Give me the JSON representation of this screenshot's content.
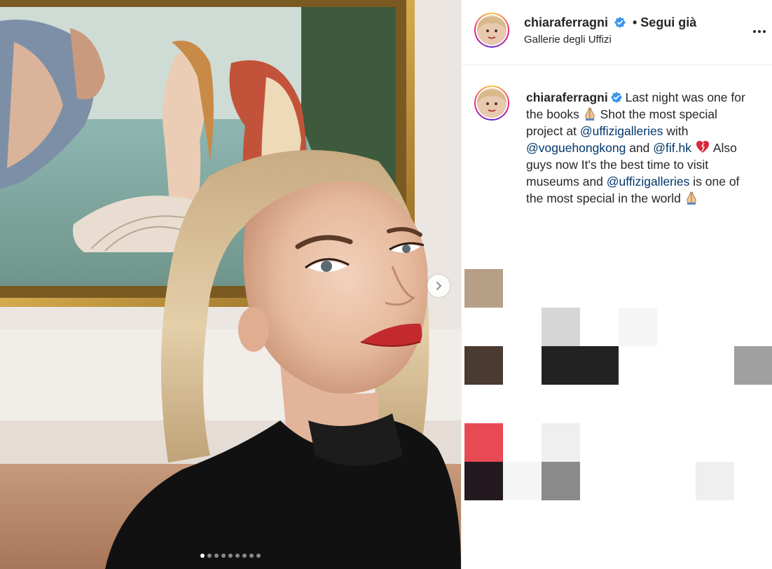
{
  "post": {
    "image_count": 9,
    "active_index": 0
  },
  "header": {
    "username": "chiaraferragni",
    "follow_status": "• Segui già",
    "location": "Gallerie degli Uffizi",
    "more_icon": "more-horizontal-icon"
  },
  "caption": {
    "username": "chiaraferragni",
    "part1": " Last night was one for the books ",
    "part2": " Shot the most special project at ",
    "mention1": "@uffizigalleries",
    "part3": " with ",
    "mention2": "@voguehongkong",
    "part4": " and ",
    "mention3": "@fif.hk",
    "part5": " Also guys now It's the best time to visit museums and ",
    "mention4": "@uffizigalleries",
    "part6": " is one of the most special in the world ",
    "emoji_pray": "folded-hands-emoji",
    "emoji_heart": "heart-emoji"
  },
  "colors": {
    "verified_blue": "#3897f0",
    "mention_blue": "#00376b",
    "lip_red": "#c22a2e"
  },
  "placeholder_tiles": [
    "#b79e86",
    "#d6d6d6",
    "#f5f5f5",
    "#4a3a30",
    "#222222",
    "#222222",
    "#a0a0a0",
    "#e84a55",
    "#efefef",
    "#23191f",
    "#f5f5f5",
    "#8a8a8a",
    "#efefef"
  ]
}
